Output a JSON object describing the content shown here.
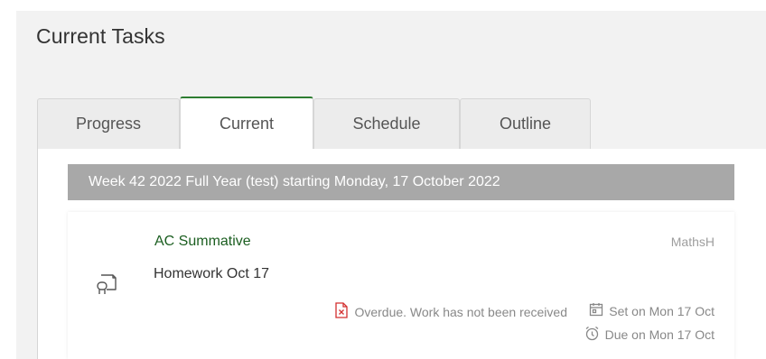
{
  "page": {
    "title": "Current Tasks"
  },
  "tabs": [
    {
      "label": "Progress",
      "active": false
    },
    {
      "label": "Current",
      "active": true
    },
    {
      "label": "Schedule",
      "active": false
    },
    {
      "label": "Outline",
      "active": false
    }
  ],
  "week": {
    "label": "Week 42 2022 Full Year (test) starting Monday, 17 October 2022"
  },
  "task": {
    "title": "AC Summative",
    "subject": "MathsH",
    "name": "Homework Oct 17",
    "status_text": "Overdue. Work has not been received",
    "set_text": "Set on Mon 17 Oct",
    "due_text": "Due on Mon 17 Oct",
    "icon": "homework-icon"
  },
  "colors": {
    "accent": "#2e7d32",
    "overdue": "#d32f2f",
    "week_bar": "#a8a8a8",
    "page_bg": "#f2f2f2"
  }
}
